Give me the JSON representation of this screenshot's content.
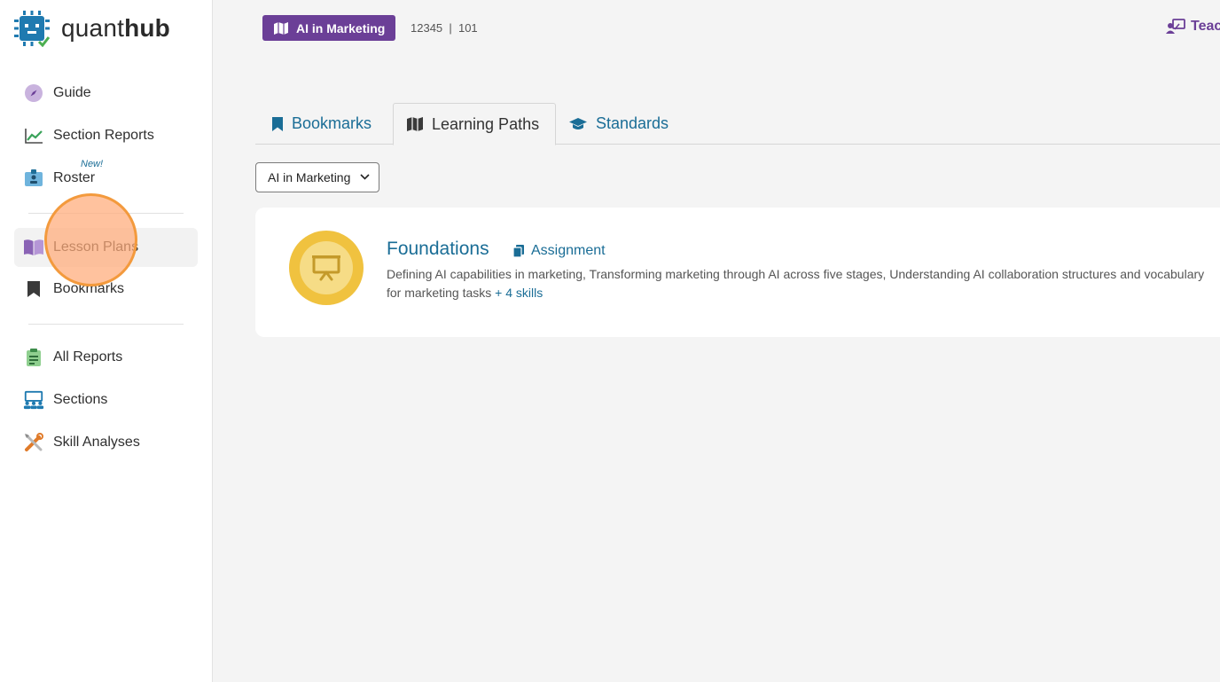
{
  "app": {
    "logo_light": "quant",
    "logo_bold": "hub"
  },
  "sidebar": {
    "items": [
      {
        "label": "Guide",
        "icon": "compass-icon"
      },
      {
        "label": "Section Reports",
        "icon": "line-chart-icon"
      },
      {
        "label": "Roster",
        "icon": "id-badge-icon",
        "badge": "New!"
      },
      {
        "label": "Lesson Plans",
        "icon": "book-icon"
      },
      {
        "label": "Bookmarks",
        "icon": "bookmark-icon"
      },
      {
        "label": "All Reports",
        "icon": "clipboard-icon"
      },
      {
        "label": "Sections",
        "icon": "classroom-icon"
      },
      {
        "label": "Skill Analyses",
        "icon": "tools-icon"
      }
    ]
  },
  "header": {
    "course_name": "AI in Marketing",
    "course_ids": "12345  |  101",
    "teacher_label": "Teacher"
  },
  "tabs": [
    {
      "label": "Bookmarks"
    },
    {
      "label": "Learning Paths"
    },
    {
      "label": "Standards"
    }
  ],
  "filter": {
    "selected": "AI in Marketing"
  },
  "card": {
    "title": "Foundations",
    "assign_label": "Assignment",
    "description": "Defining AI capabilities in marketing, Transforming marketing through AI across five stages, Understanding AI collaboration structures and vocabulary for marketing tasks",
    "more_skills": "+ 4 skills"
  },
  "colors": {
    "brand_purple": "#6b3f97",
    "link_blue": "#1a6d96",
    "badge_yellow": "#f0c23f"
  }
}
